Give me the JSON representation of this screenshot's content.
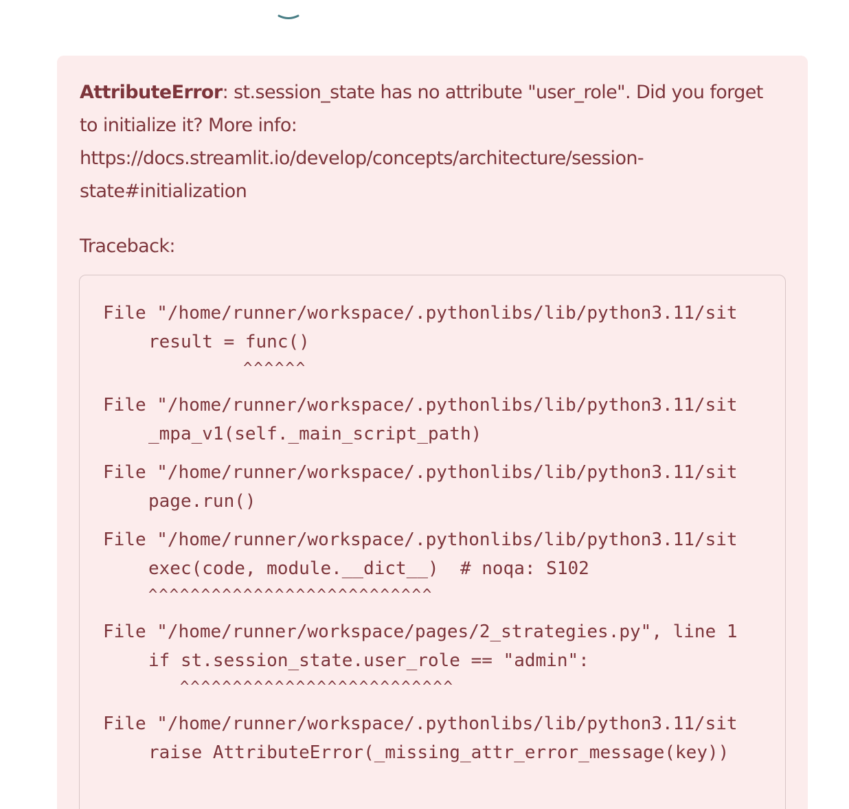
{
  "error": {
    "name": "AttributeError",
    "message_lines": [
      ": st.session_state has no attribute \"user_role\". Did you forget",
      "to initialize it? More info:",
      "https://docs.streamlit.io/develop/concepts/architecture/session-",
      "state#initialization"
    ],
    "traceback_label": "Traceback:"
  },
  "traceback": [
    {
      "file": "File \"/home/runner/workspace/.pythonlibs/lib/python3.11/sit",
      "code": "result = func()",
      "caret": "         ^^^^^^"
    },
    {
      "file": "File \"/home/runner/workspace/.pythonlibs/lib/python3.11/sit",
      "code": "_mpa_v1(self._main_script_path)",
      "caret": null
    },
    {
      "file": "File \"/home/runner/workspace/.pythonlibs/lib/python3.11/sit",
      "code": "page.run()",
      "caret": null
    },
    {
      "file": "File \"/home/runner/workspace/.pythonlibs/lib/python3.11/sit",
      "code": "exec(code, module.__dict__)  # noqa: S102",
      "caret": "^^^^^^^^^^^^^^^^^^^^^^^^^^^"
    },
    {
      "file": "File \"/home/runner/workspace/pages/2_strategies.py\", line 1",
      "code": "if st.session_state.user_role == \"admin\":",
      "caret": "   ^^^^^^^^^^^^^^^^^^^^^^^^^^"
    },
    {
      "file": "File \"/home/runner/workspace/.pythonlibs/lib/python3.11/sit",
      "code": "raise AttributeError(_missing_attr_error_message(key))",
      "caret": null
    }
  ],
  "colors": {
    "error_bg": "#fcecec",
    "error_text": "#7d353b",
    "code_border": "#d7c5c6"
  }
}
